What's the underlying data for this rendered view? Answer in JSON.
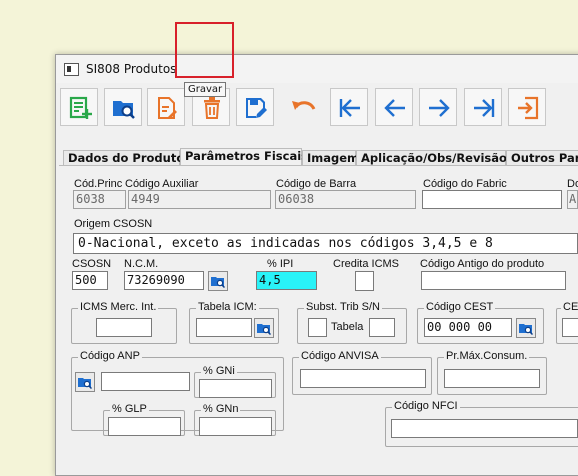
{
  "window": {
    "title": "SI808 Produtos"
  },
  "toolbar": {
    "buttons": [
      "new-record",
      "search-folder",
      "edit-document",
      "delete",
      "save",
      "undo",
      "first",
      "previous",
      "next",
      "last",
      "exit"
    ],
    "tooltip": "Gravar"
  },
  "tabs": [
    "Dados do  Produto",
    "Parâmetros Fiscais",
    "Imagem",
    "Aplicação/Obs/Revisão",
    "Outros Parâ"
  ],
  "active_tab": "Parâmetros Fiscais",
  "form": {
    "cod_princ_label": "Cód.Princ",
    "cod_princ_value": "6038",
    "cod_aux_label": "Código Auxiliar",
    "cod_aux_value": "4949",
    "cod_barra_label": "Código de Barra",
    "cod_barra_value": "06038",
    "cod_fabric_label": "Código do Fabric",
    "cod_fabric_value": "",
    "cut_label": "Do",
    "cut_value": "A",
    "origem_label": "Origem CSOSN",
    "origem_value": "0-Nacional, exceto as indicadas nos códigos 3,4,5 e 8",
    "csosn_label": "CSOSN",
    "csosn_value": "500",
    "ncm_label": "N.C.M.",
    "ncm_value": "73269090",
    "ipi_label": "% IPI",
    "ipi_value": "4,5",
    "credita_label": "Credita ICMS",
    "cod_antigo_label": "Código Antigo do produto",
    "cod_antigo_value": "",
    "icms_merc_label": "ICMS Merc. Int.",
    "tabela_icm_label": "Tabela ICM:",
    "subst_label": "Subst. Trib S/N",
    "tabela_label": "Tabela",
    "cest_label": "Código CEST",
    "cest_value": "00 000 00",
    "ce_label": "CE",
    "anp_label": "Código ANP",
    "gni_label": "% GNi",
    "glp_label": "% GLP",
    "gnn_label": "% GNn",
    "anvisa_label": "Código ANVISA",
    "prmax_label": "Pr.Máx.Consum.",
    "nfci_label": "Código NFCI"
  },
  "colors": {
    "highlight": "#d8202a",
    "ipi_field": "#29f3f8",
    "icon_green": "#2aa84a",
    "icon_blue": "#1f6fd0",
    "icon_orange": "#e8742a"
  }
}
